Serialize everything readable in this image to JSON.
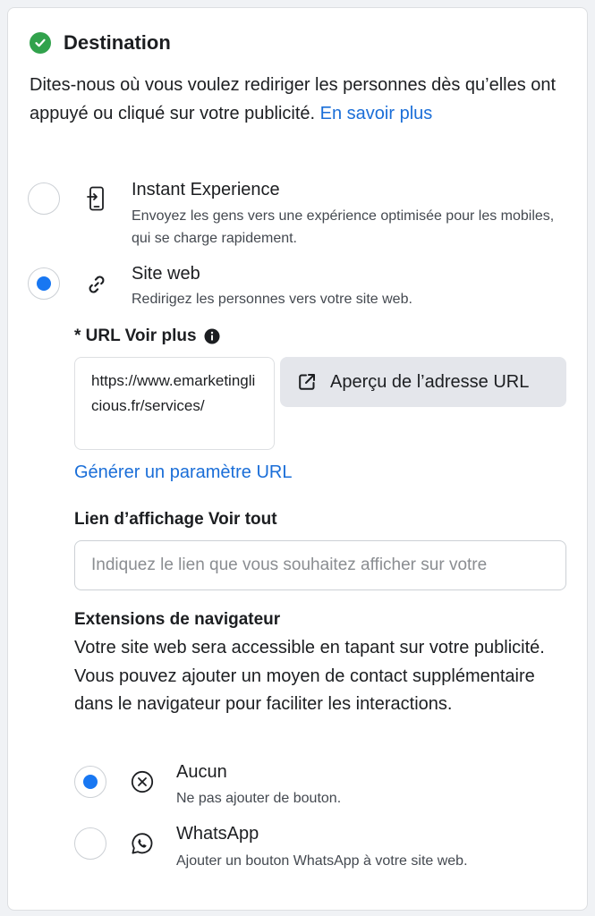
{
  "section": {
    "title": "Destination",
    "description": "Dites-nous où vous voulez rediriger les personnes dès qu’elles ont appuyé ou cliqué sur votre publicité.",
    "learn_more": "En savoir plus"
  },
  "destination_options": [
    {
      "title": "Instant Experience",
      "subtitle": "Envoyez les gens vers une expérience optimisée pour les mobiles, qui se charge rapidement.",
      "icon": "mobile-screen-icon",
      "selected": false
    },
    {
      "title": "Site web",
      "subtitle": "Redirigez les personnes vers votre site web.",
      "icon": "link-icon",
      "selected": true
    }
  ],
  "url_field": {
    "label": "* URL Voir plus",
    "value": "https://www.emarketinglicious.fr/services/",
    "info_icon": "info-icon",
    "preview_button": "Aperçu de l’adresse URL",
    "preview_icon": "external-link-icon",
    "generate_link": "Générer un paramètre URL"
  },
  "display_link": {
    "label": "Lien d’affichage Voir tout",
    "placeholder": "Indiquez le lien que vous souhaitez afficher sur votre"
  },
  "browser_extensions": {
    "heading": "Extensions de navigateur",
    "description": "Votre site web sera accessible en tapant sur votre publicité. Vous pouvez ajouter un moyen de contact supplémentaire dans le navigateur pour faciliter les interactions.",
    "options": [
      {
        "title": "Aucun",
        "subtitle": "Ne pas ajouter de bouton.",
        "icon": "circle-x-icon",
        "selected": true
      },
      {
        "title": "WhatsApp",
        "subtitle": "Ajouter un bouton WhatsApp à votre site web.",
        "icon": "whatsapp-icon",
        "selected": false
      }
    ]
  },
  "colors": {
    "accent": "#1877f2",
    "link": "#1a6ed8",
    "success": "#31a24c"
  }
}
